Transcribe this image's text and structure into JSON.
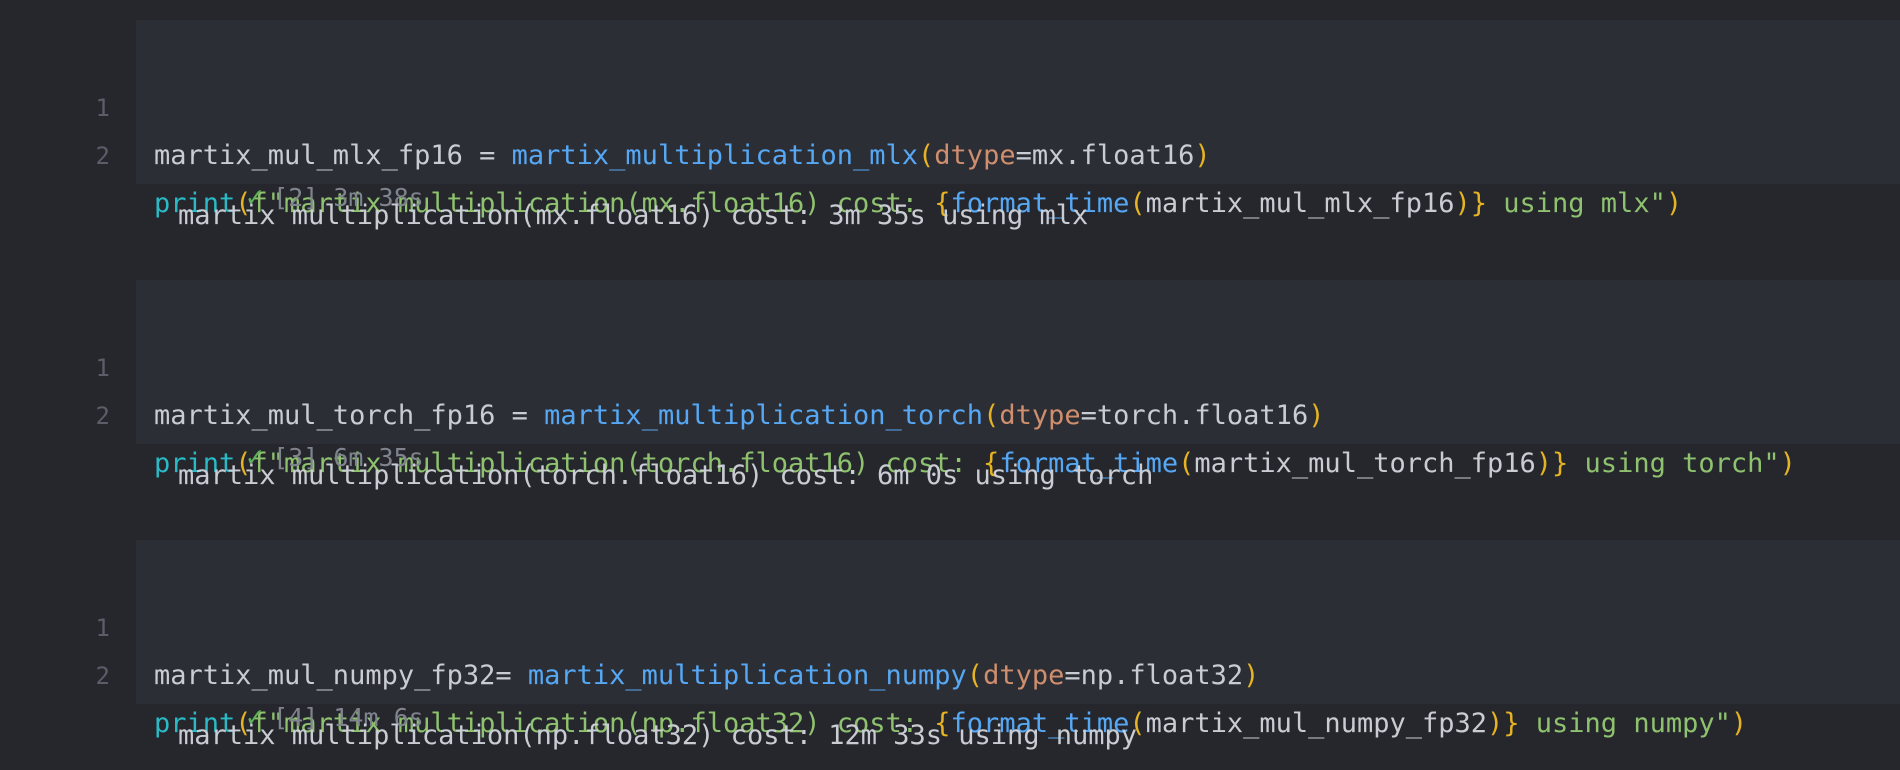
{
  "cells": [
    {
      "line_numbers": [
        "1",
        "2"
      ],
      "line1": {
        "var": "martix_mul_mlx_fp16",
        "assign": " = ",
        "fn": "martix_multiplication_mlx",
        "open": "(",
        "kw": "dtype",
        "eq": "=",
        "arg": "mx.float16",
        "close": ")"
      },
      "line2": {
        "builtin": "print",
        "open": "(",
        "str_start": "f\"martix multiplication(mx.float16) cost: ",
        "brace_open": "{",
        "fn": "format_time",
        "inner_open": "(",
        "arg": "martix_mul_mlx_fp16",
        "inner_close": ")",
        "brace_close": "}",
        "str_end": " using mlx\"",
        "close": ")"
      },
      "status": "[2] 3m 38s",
      "output": "martix multiplication(mx.float16) cost: 3m 35s using mlx"
    },
    {
      "line_numbers": [
        "1",
        "2"
      ],
      "line1": {
        "var": "martix_mul_torch_fp16",
        "assign": " = ",
        "fn": "martix_multiplication_torch",
        "open": "(",
        "kw": "dtype",
        "eq": "=",
        "arg": "torch.float16",
        "close": ")"
      },
      "line2": {
        "builtin": "print",
        "open": "(",
        "str_start": "f\"martix multiplication(torch.float16) cost: ",
        "brace_open": "{",
        "fn": "format_time",
        "inner_open": "(",
        "arg": "martix_mul_torch_fp16",
        "inner_close": ")",
        "brace_close": "}",
        "str_end": " using torch\"",
        "close": ")"
      },
      "status": "[3] 6m 35s",
      "output": "martix multiplication(torch.float16) cost: 6m 0s using torch"
    },
    {
      "line_numbers": [
        "1",
        "2"
      ],
      "line1": {
        "var": "martix_mul_numpy_fp32",
        "assign": "= ",
        "fn": "martix_multiplication_numpy",
        "open": "(",
        "kw": "dtype",
        "eq": "=",
        "arg": "np.float32",
        "close": ")"
      },
      "line2": {
        "builtin": "print",
        "open": "(",
        "str_start": "f\"martix multiplication(np.float32) cost: ",
        "brace_open": "{",
        "fn": "format_time",
        "inner_open": "(",
        "arg": "martix_mul_numpy_fp32",
        "inner_close": ")",
        "brace_close": "}",
        "str_end": " using numpy\"",
        "close": ")"
      },
      "status": "[4] 14m 6s",
      "output": "martix multiplication(np.float32) cost: 12m 33s using numpy"
    }
  ],
  "icons": {
    "status": "checkmark-icon"
  },
  "colors": {
    "background": "#25272d",
    "code_background": "#2c2e35",
    "function": "#56a8f5",
    "keyword": "#cf8e6d",
    "builtin": "#2bbac5",
    "string": "#8fc26e",
    "paren": "#e6b422",
    "success": "#5fb05a"
  }
}
